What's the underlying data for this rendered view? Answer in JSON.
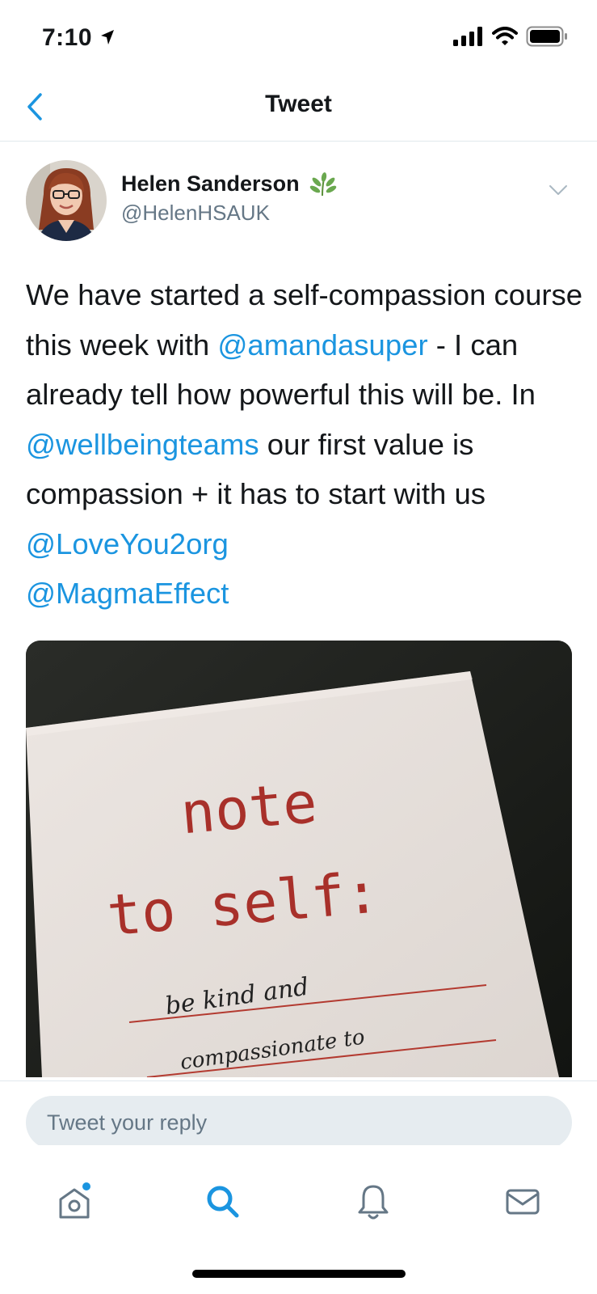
{
  "status_bar": {
    "time": "7:10"
  },
  "nav": {
    "title": "Tweet"
  },
  "tweet": {
    "author": {
      "name": "Helen Sanderson",
      "handle": "@HelenHSAUK"
    },
    "text": {
      "p1": "We have started a self-compassion course this week with ",
      "m1": "@amandasuper",
      "p2": " - I can already tell how powerful this will be. In ",
      "m2": "@wellbeingteams",
      "p3": " our first value is compassion + it has to start with us ",
      "m3": "@LoveYou2org",
      "p4": " ",
      "m4": "@MagmaEffect"
    },
    "media": {
      "line1": "note",
      "line2": "to self:",
      "hand1": "be kind and",
      "hand2": "compassionate to"
    }
  },
  "reply": {
    "placeholder": "Tweet your reply"
  },
  "tabs": [
    {
      "icon": "home-icon",
      "active": false,
      "badge": true
    },
    {
      "icon": "search-icon",
      "active": true
    },
    {
      "icon": "notifications-icon",
      "active": false
    },
    {
      "icon": "messages-icon",
      "active": false
    }
  ],
  "colors": {
    "accent": "#1b95e0",
    "text": "#14171a",
    "secondary": "#657786",
    "stamp_red": "#a8302a"
  }
}
